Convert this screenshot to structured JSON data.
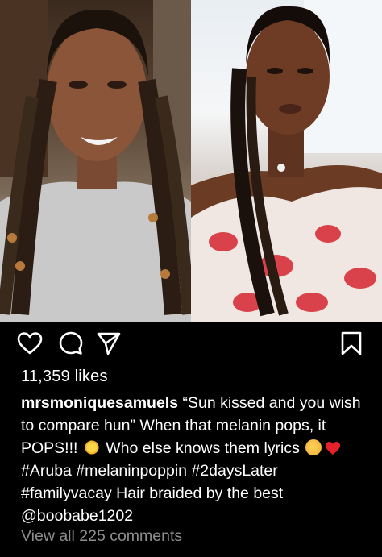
{
  "post": {
    "likes_text": "11,359 likes",
    "caption": {
      "username": "mrsmoniquesamuels",
      "text_1": " “Sun kissed and you wish to compare hun” When that melanin pops, it POPS!!! ",
      "text_2": " Who else knows them lyrics ",
      "text_3": " ",
      "hashtag_1": "#Aruba",
      "hashtag_2": "#melaninpoppin",
      "hashtag_3": "#2daysLater",
      "hashtag_4": "#familyvacay",
      "text_4": " Hair braided by the best ",
      "mention": "@boobabe1202"
    },
    "view_comments_text": "View all 225 comments"
  },
  "icons": {
    "like": "heart-icon",
    "comment": "comment-icon",
    "share": "paper-plane-icon",
    "save": "bookmark-icon",
    "emoji_sun": "sun-emoji",
    "emoji_think": "thinking-face-emoji",
    "emoji_heart": "red-heart-emoji"
  },
  "colors": {
    "background": "#000000",
    "text": "#ffffff",
    "muted": "#8e8e8e",
    "heart_red": "#e8202a"
  }
}
